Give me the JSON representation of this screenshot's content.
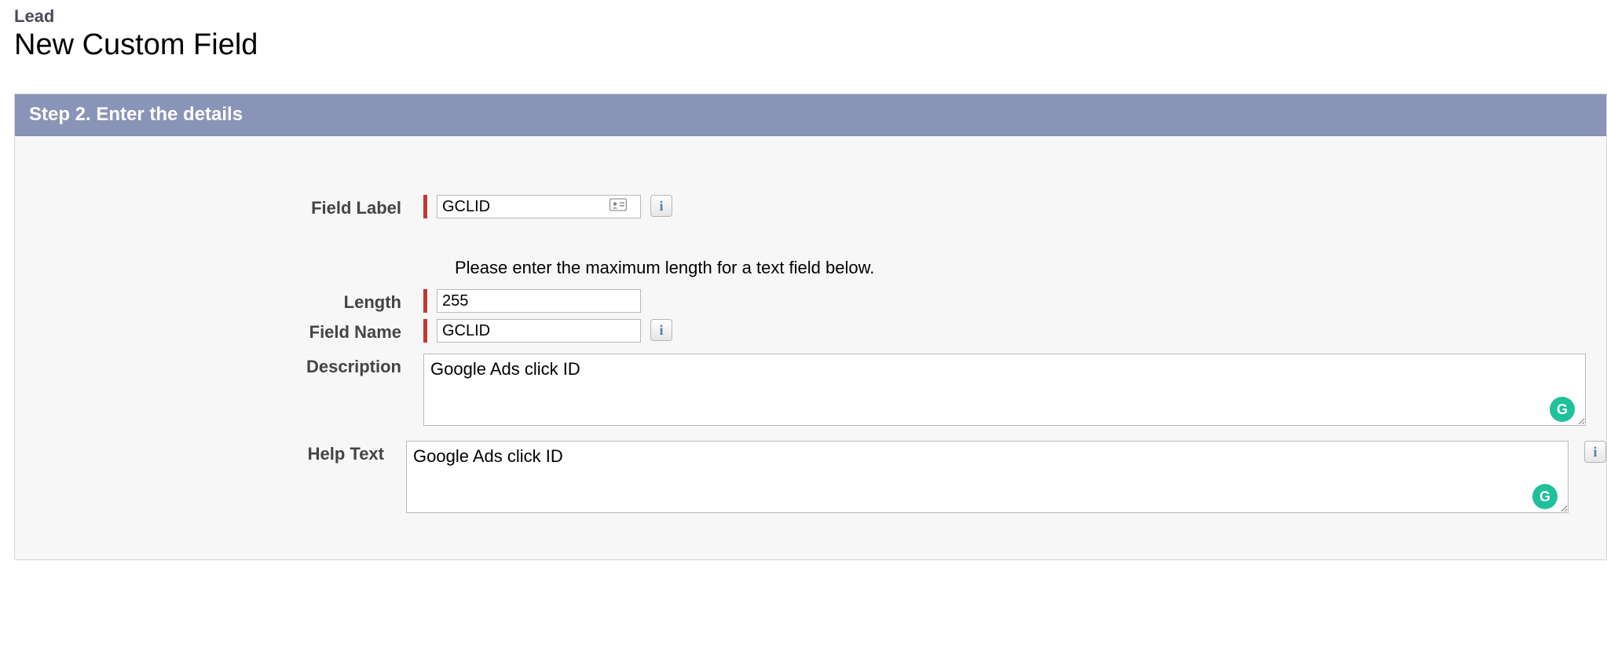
{
  "header": {
    "breadcrumb": "Lead",
    "title": "New Custom Field"
  },
  "panel": {
    "step_title": "Step 2. Enter the details"
  },
  "form": {
    "field_label": {
      "label": "Field Label",
      "value": "GCLID"
    },
    "length_instruction": "Please enter the maximum length for a text field below.",
    "length": {
      "label": "Length",
      "value": "255"
    },
    "field_name": {
      "label": "Field Name",
      "value": "GCLID"
    },
    "description": {
      "label": "Description",
      "value": "Google Ads click ID"
    },
    "help_text": {
      "label": "Help Text",
      "value": "Google Ads click ID"
    }
  },
  "icons": {
    "info": "i",
    "grammarly": "G"
  }
}
